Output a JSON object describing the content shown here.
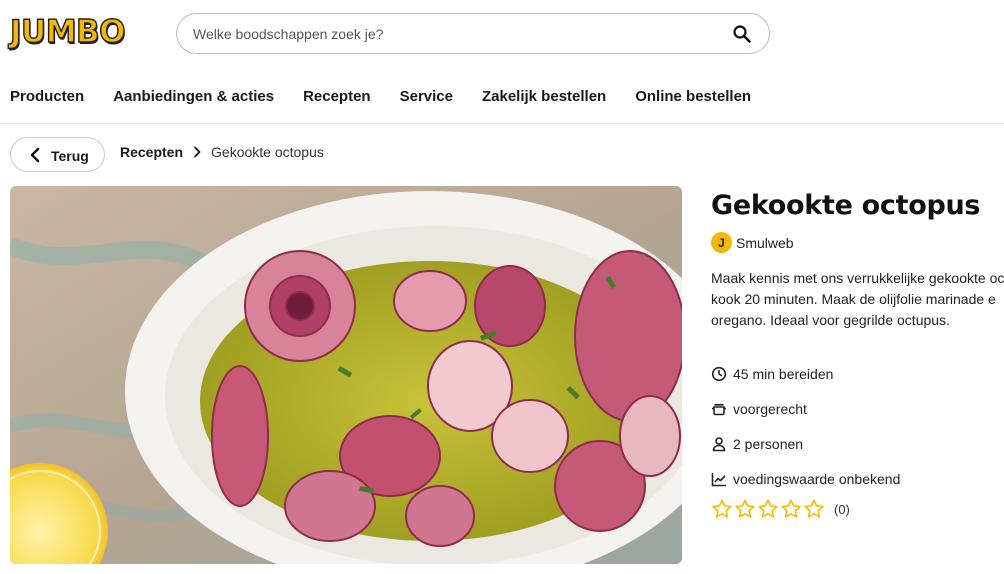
{
  "header": {
    "logo_text": "JUMBO",
    "search_placeholder": "Welke boodschappen zoek je?"
  },
  "nav": {
    "items": [
      {
        "label": "Producten"
      },
      {
        "label": "Aanbiedingen & acties"
      },
      {
        "label": "Recepten"
      },
      {
        "label": "Service"
      },
      {
        "label": "Zakelijk bestellen"
      },
      {
        "label": "Online bestellen"
      }
    ]
  },
  "breadcrumb": {
    "back_label": "Terug",
    "parent": "Recepten",
    "current": "Gekookte octopus"
  },
  "recipe": {
    "title": "Gekookte octopus",
    "author_initial": "J",
    "author": "Smulweb",
    "description_lines": [
      "Maak kennis met ons verrukkelijke gekookte oc",
      "kook 20 minuten. Maak de olijfolie marinade e",
      "oregano. Ideaal voor gegrilde octupus."
    ],
    "meta": {
      "prep_time": "45 min bereiden",
      "course": "voorgerecht",
      "servings": "2 personen",
      "nutrition": "voedingswaarde onbekend"
    },
    "rating": {
      "stars_filled": 0,
      "stars_total": 5,
      "count_label": "(0)"
    }
  },
  "colors": {
    "brand_yellow": "#f5b800",
    "text": "#1a1a1a",
    "border": "#c9c9c9"
  }
}
